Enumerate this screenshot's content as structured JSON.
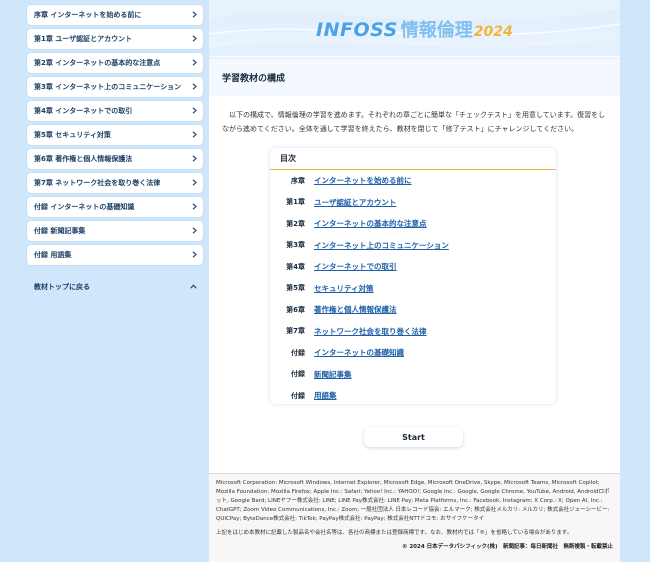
{
  "sidebar": {
    "items": [
      {
        "label": "序章 インターネットを始める前に"
      },
      {
        "label": "第1章 ユーザ認証とアカウント"
      },
      {
        "label": "第2章 インターネットの基本的な注意点"
      },
      {
        "label": "第3章 インターネット上のコミュニケーション"
      },
      {
        "label": "第4章 インターネットでの取引"
      },
      {
        "label": "第5章 セキュリティ対策"
      },
      {
        "label": "第6章 著作権と個人情報保護法"
      },
      {
        "label": "第7章 ネットワーク社会を取り巻く法律"
      },
      {
        "label": "付録 インターネットの基礎知識"
      },
      {
        "label": "付録 新聞記事集"
      },
      {
        "label": "付録 用語集"
      }
    ],
    "back_label": "教材トップに戻る"
  },
  "header": {
    "logo_en": "INFOSS",
    "logo_jp": "情報倫理",
    "logo_year": "2024"
  },
  "section": {
    "title": "学習教材の構成"
  },
  "intro": {
    "text": "以下の構成で、情報倫理の学習を進めます。それぞれの章ごとに簡単な「チェックテスト」を用意しています。復習をしながら進めてください。全体を通して学習を終えたら、教材を閉じて「修了テスト」にチャレンジしてください。"
  },
  "toc": {
    "heading": "目次",
    "rows": [
      {
        "chapter": "序章",
        "title": "インターネットを始める前に"
      },
      {
        "chapter": "第1章",
        "title": "ユーザ認証とアカウント"
      },
      {
        "chapter": "第2章",
        "title": "インターネットの基本的な注意点"
      },
      {
        "chapter": "第3章",
        "title": "インターネット上のコミュニケーション"
      },
      {
        "chapter": "第4章",
        "title": "インターネットでの取引"
      },
      {
        "chapter": "第5章",
        "title": "セキュリティ対策"
      },
      {
        "chapter": "第6章",
        "title": "著作権と個人情報保護法"
      },
      {
        "chapter": "第7章",
        "title": "ネットワーク社会を取り巻く法律"
      },
      {
        "chapter": "付録",
        "title": "インターネットの基礎知識"
      },
      {
        "chapter": "付録",
        "title": "新聞記事集"
      },
      {
        "chapter": "付録",
        "title": "用語集"
      }
    ]
  },
  "start_label": "Start",
  "footer": {
    "trademarks": "Microsoft Corporation: Microsoft Windows, Internet Explorer, Microsoft Edge, Microsoft OneDrive, Skype, Microsoft Teams, Microsoft Copilot; Mozilla Foundation: Mozilla Firefox; Apple Inc.: Safari; Yahoo! Inc.: YAHOO!; Google Inc.: Google, Google Chrome, YouTube, Android, Androidロボット, Google Bard; LINEヤフー株式会社: LINE; LINE Pay株式会社: LINE Pay; Meta Platforms, Inc.: Facebook, Instagram; X Corp.: X; Open AI, Inc.: ChatGPT; Zoom Video Communications, Inc.: Zoom; 一般社団法人 日本レコード協会: エルマーク; 株式会社メルカリ: メルカリ; 株式会社ジェーシービー: QUICPay; ByteDance株式会社: TikTok; PayPay株式会社: PayPay; 株式会社NTTドコモ: おサイフケータイ",
    "note": "上記をはじめ本教材に記載した製品名や会社名等は、各社の商標または登録商標です。なお、教材内では「®」を省略している場合があります。",
    "copyright": "© 2024 日本データパシフィック(株)　新聞記事：毎日新聞社　無断複製・転載禁止"
  },
  "colors": {
    "sidebar_bg": "#cfe6fb",
    "accent_link": "#1e5fa8",
    "toc_rule": "#f2b53a",
    "logo_blue": "#4aa3e6",
    "logo_year": "#f2b53a"
  },
  "icons": {
    "nav_item": "chevron-right-icon",
    "back_link": "chevron-up-icon"
  }
}
